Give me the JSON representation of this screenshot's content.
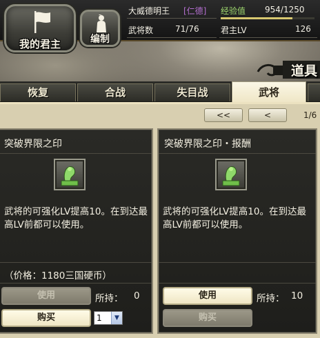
{
  "header": {
    "lord_button_label": "我的君主",
    "org_button_label": "编制",
    "lord_name": "大威德明王",
    "virtue": "[仁德]",
    "general_count_label": "武将数",
    "general_count_value": "71/76",
    "exp_label": "经验值",
    "exp_value": "954/1250",
    "exp_progress": 0.763,
    "lord_lv_label": "君主LV",
    "lord_lv_value": "126"
  },
  "section_title": "道具",
  "tabs": [
    {
      "label": "恢复",
      "active": false
    },
    {
      "label": "合战",
      "active": false
    },
    {
      "label": "失目战",
      "active": false
    },
    {
      "label": "武将",
      "active": true
    }
  ],
  "pager": {
    "first_label": "<<",
    "prev_label": "<",
    "page": "1/6"
  },
  "items": [
    {
      "title": "突破界限之印",
      "icon": "seal-icon",
      "description": "武将的可强化LV提高10。在到达最高LV前都可以使用。",
      "price": "（价格：1180三国硬币）",
      "use_label": "使用",
      "use_enabled": false,
      "hold_label": "所持：",
      "hold_value": "0",
      "buy_label": "购买",
      "qty": "1"
    },
    {
      "title": "突破界限之印・报酬",
      "icon": "seal-icon",
      "description": "武将的可强化LV提高10。在到达最高LV前都可以使用。",
      "use_label": "使用",
      "use_enabled": true,
      "hold_label": "所持：",
      "hold_value": "10",
      "buy_label": "购买",
      "buy_enabled": false
    }
  ],
  "colors": {
    "virtue": "#b46fd0",
    "exp_label": "#9fd86f",
    "exp_bar": "#d8c870"
  }
}
